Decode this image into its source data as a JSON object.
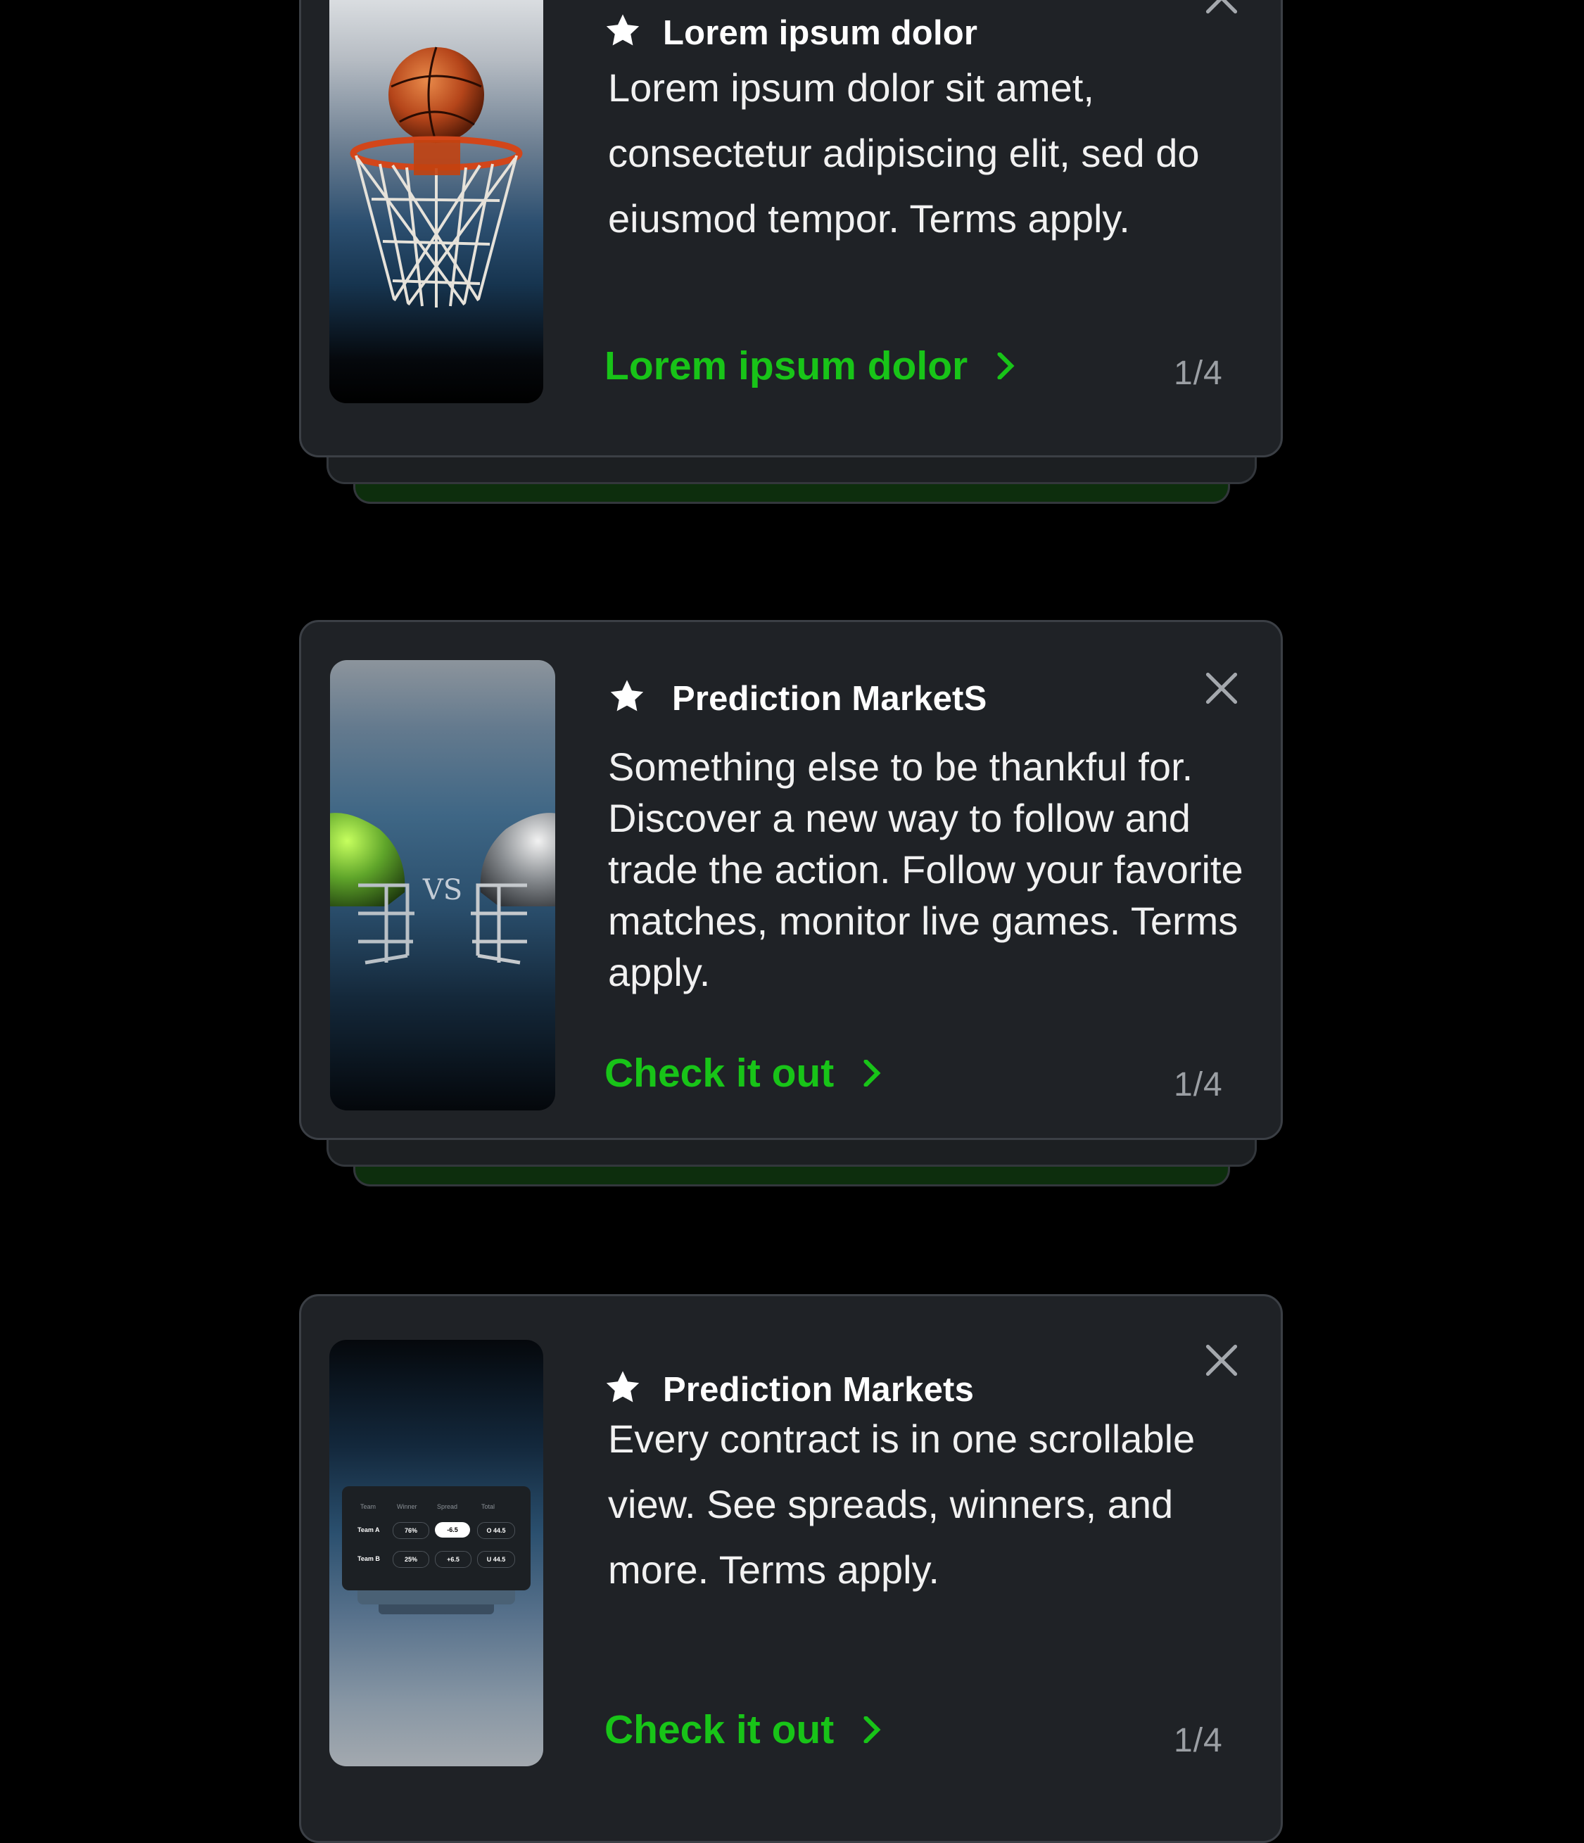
{
  "cards": [
    {
      "title": "Lorem ipsum dolor",
      "body": "Lorem ipsum dolor sit amet, consectetur adipiscing elit, sed do eiusmod tempor. Terms apply.",
      "cta": "Lorem ipsum dolor",
      "counter": "1/4",
      "icon": "star-icon"
    },
    {
      "title": "Prediction MarketS",
      "body": "Something else to be thankful for. Discover a new way to follow and trade the action. Follow your favorite matches, monitor live games. Terms apply.",
      "cta": "Check it out",
      "counter": "1/4",
      "icon": "star-icon",
      "thumb_text": "VS"
    },
    {
      "title": "Prediction Markets",
      "body": "Every contract is in one scrollable view. See spreads, winners, and more. Terms apply.",
      "cta": "Check it out",
      "counter": "1/4",
      "icon": "star-icon",
      "mini_table": {
        "headers": [
          "Team",
          "Winner",
          "Spread",
          "Total"
        ],
        "rows": [
          {
            "team": "Team A",
            "winner": "76%",
            "spread": "-6.5",
            "total": "O 44.5"
          },
          {
            "team": "Team B",
            "winner": "25%",
            "spread": "+6.5",
            "total": "U 44.5"
          }
        ]
      }
    }
  ],
  "colors": {
    "background": "#000000",
    "card": "#1f2226",
    "accent_green": "#18c418",
    "counter_gray": "#9b9fa4"
  }
}
